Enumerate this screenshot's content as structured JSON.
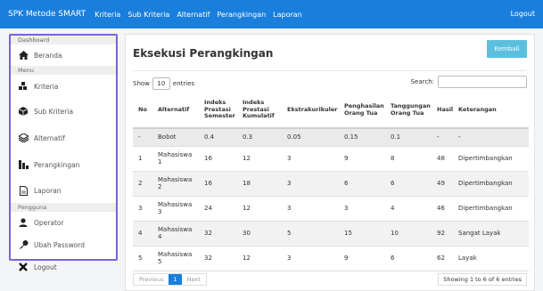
{
  "navbar": {
    "brand": "SPK Metode SMART",
    "links": [
      "Kriteria",
      "Sub Kriteria",
      "Alternatif",
      "Perangkingan",
      "Laporan"
    ],
    "logout": "Logout"
  },
  "sidebar": {
    "section_dashboard": "Dashboard",
    "section_menu": "Menu",
    "section_pengguna": "Pengguna",
    "items": {
      "beranda": {
        "label": "Beranda",
        "icon": "home-icon"
      },
      "kriteria": {
        "label": "Kriteria",
        "icon": "cubes-icon"
      },
      "sub_kriteria": {
        "label": "Sub Kriteria",
        "icon": "cube-icon"
      },
      "alternatif": {
        "label": "Alternatif",
        "icon": "layers-icon"
      },
      "perangkingan": {
        "label": "Perangkingan",
        "icon": "bar-chart-icon"
      },
      "laporan": {
        "label": "Laporan",
        "icon": "file-icon"
      },
      "operator": {
        "label": "Operator",
        "icon": "user-icon"
      },
      "ubah_password": {
        "label": "Ubah Password",
        "icon": "key-icon"
      },
      "logout": {
        "label": "Logout",
        "icon": "close-icon"
      }
    }
  },
  "main": {
    "title": "Eksekusi Perangkingan",
    "back_button": "Kembali",
    "show_label": "Show",
    "entries_value": "10",
    "entries_label": "entries",
    "search_label": "Search:",
    "columns": [
      "No",
      "Alternatif",
      "Indeks Prestasi Semester",
      "Indeks Prestasi Kumulatif",
      "Ekstrakurikuler",
      "Penghasilan Orang Tua",
      "Tanggungan Orang Tua",
      "Hasil",
      "Keterangan"
    ],
    "bobot_row": [
      "-",
      "Bobot",
      "0.4",
      "0.3",
      "0.05",
      "0.15",
      "0.1",
      "-",
      "-"
    ],
    "rows": [
      [
        "1",
        "Mahasiswa 1",
        "16",
        "12",
        "3",
        "9",
        "8",
        "48",
        "Dipertimbangkan"
      ],
      [
        "2",
        "Mahasiswa 2",
        "16",
        "18",
        "3",
        "6",
        "6",
        "49",
        "Dipertimbangkan"
      ],
      [
        "3",
        "Mahasiswa 3",
        "24",
        "12",
        "3",
        "3",
        "4",
        "46",
        "Dipertimbangkan"
      ],
      [
        "4",
        "Mahasiswa 4",
        "32",
        "30",
        "5",
        "15",
        "10",
        "92",
        "Sangat Layak"
      ],
      [
        "5",
        "Mahasiswa 5",
        "32",
        "12",
        "3",
        "9",
        "6",
        "62",
        "Layak"
      ]
    ],
    "pager": {
      "previous": "Previous",
      "page": "1",
      "next": "Next"
    },
    "info": "Showing 1 to 6 of 6 entries"
  }
}
